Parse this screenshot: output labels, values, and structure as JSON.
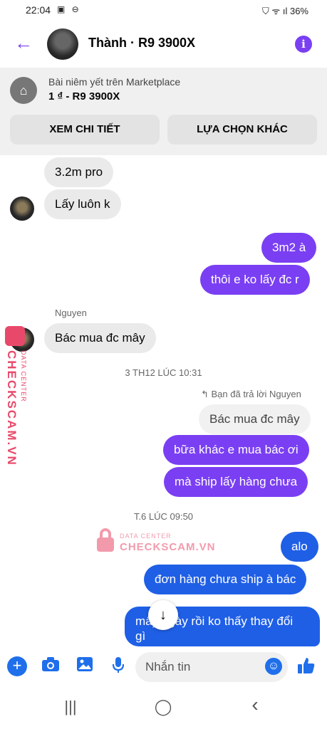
{
  "status_bar": {
    "time": "22:04",
    "icons_left": "▣ ⊖",
    "battery": "36%",
    "icons_right": "⛉ ᯤ ıl"
  },
  "header": {
    "title": "Thành · R9 3900X",
    "back_icon": "←",
    "info_icon": "i"
  },
  "marketplace": {
    "label": "Bài niêm yết trên Marketplace",
    "title": "1 ₫ - R9 3900X",
    "btn_details": "XEM CHI TIẾT",
    "btn_options": "LỰA CHỌN KHÁC"
  },
  "messages": {
    "m1": "3.2m pro",
    "m2": "Lấy luôn k",
    "m3": "3m2 à",
    "m4": "thôi e ko lấy đc r",
    "sender_name": "Nguyen",
    "m5": "Bác mua đc mây",
    "timestamp1": "3 TH12 LÚC 10:31",
    "reply_note": "↰ Bạn đã trả lời Nguyen",
    "quoted": "Bác mua đc mây",
    "m6": "bữa khác e mua bác ơi",
    "m7": "mà ship lấy hàng chưa",
    "timestamp2": "T.6 LÚC 09:50",
    "m8": "alo",
    "m9": "đơn hàng chưa ship à bác",
    "m10_line1": "mấy ngày rồi ko thấy thay đổi",
    "m10_line2": "gì"
  },
  "watermark": {
    "sub": "DATA CENTER",
    "main": "CHECKSCAM.VN"
  },
  "composer": {
    "placeholder": "Nhắn tin"
  },
  "nav": {
    "recent": "|||",
    "home": "◯",
    "back": "‹"
  },
  "colors": {
    "accent_purple": "#7a3ff2",
    "accent_blue": "#1f5fe6"
  }
}
